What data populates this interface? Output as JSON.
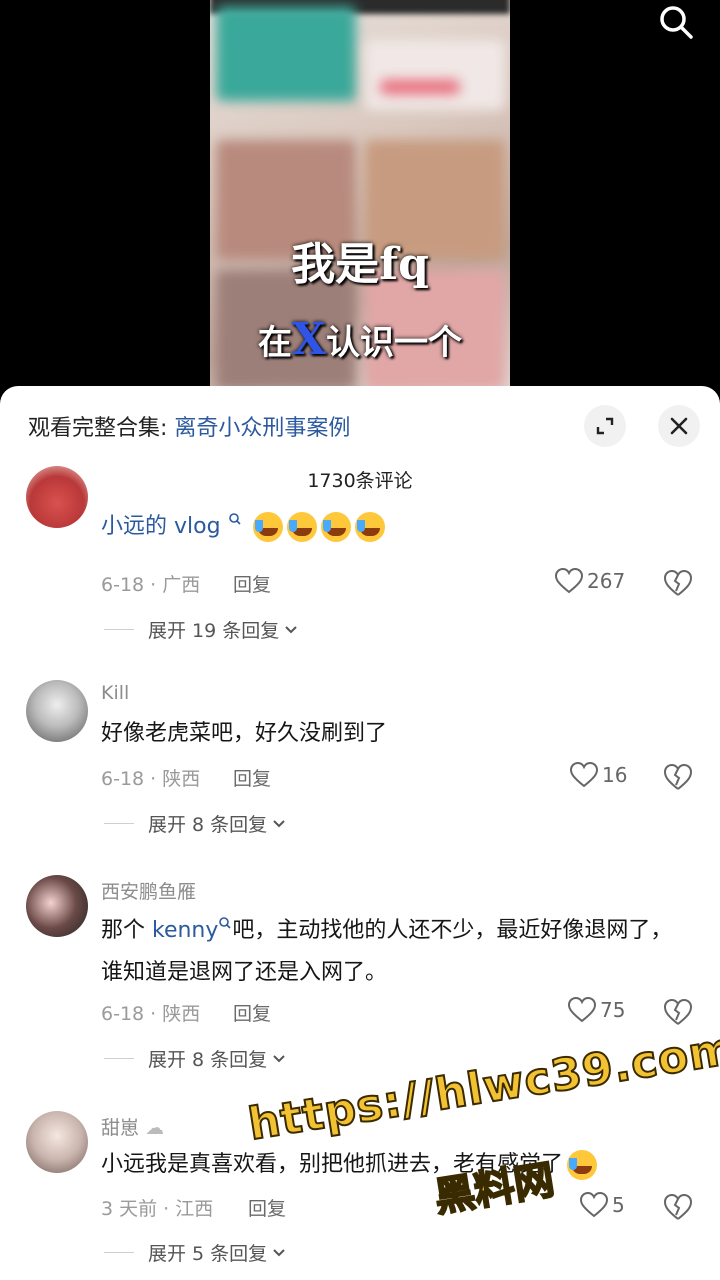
{
  "video": {
    "overlay_line1": "我是fq",
    "overlay_line2_pre": "在",
    "overlay_line2_x": "X",
    "overlay_line2_post": "认识一个",
    "search_icon": "search-icon"
  },
  "sheet": {
    "collection_prefix": "观看完整合集: ",
    "collection_name": "离奇小众刑事案例",
    "comment_count": "1730条评论"
  },
  "comments": [
    {
      "name": "小远的 vlog",
      "date_region": "6-18 · 广西",
      "reply": "回复",
      "likes": "267",
      "expand": "展开 19 条回复"
    },
    {
      "name": "Kill",
      "text": "好像老虎菜吧，好久没刷到了",
      "date_region": "6-18 · 陕西",
      "reply": "回复",
      "likes": "16",
      "expand": "展开 8 条回复"
    },
    {
      "name": "西安鹏鱼雁",
      "text_pre": "那个 ",
      "mention": "kenny",
      "text_post": "吧，主动找他的人还不少，最近好像退网了，谁知道是退网了还是入网了。",
      "date_region": "6-18 · 陕西",
      "reply": "回复",
      "likes": "75",
      "expand": "展开 8 条回复"
    },
    {
      "name": "甜崽",
      "text": "小远我是真喜欢看，别把他抓进去，老有感觉了",
      "date_region": "3 天前 · 江西",
      "reply": "回复",
      "likes": "5",
      "expand": "展开 5 条回复"
    }
  ],
  "watermark": {
    "url": "https://hlwc39.com",
    "name": "黑料网"
  },
  "colors": {
    "link": "#2b5a9e",
    "meta": "#9a9a9a",
    "watermark": "#f2c233"
  }
}
